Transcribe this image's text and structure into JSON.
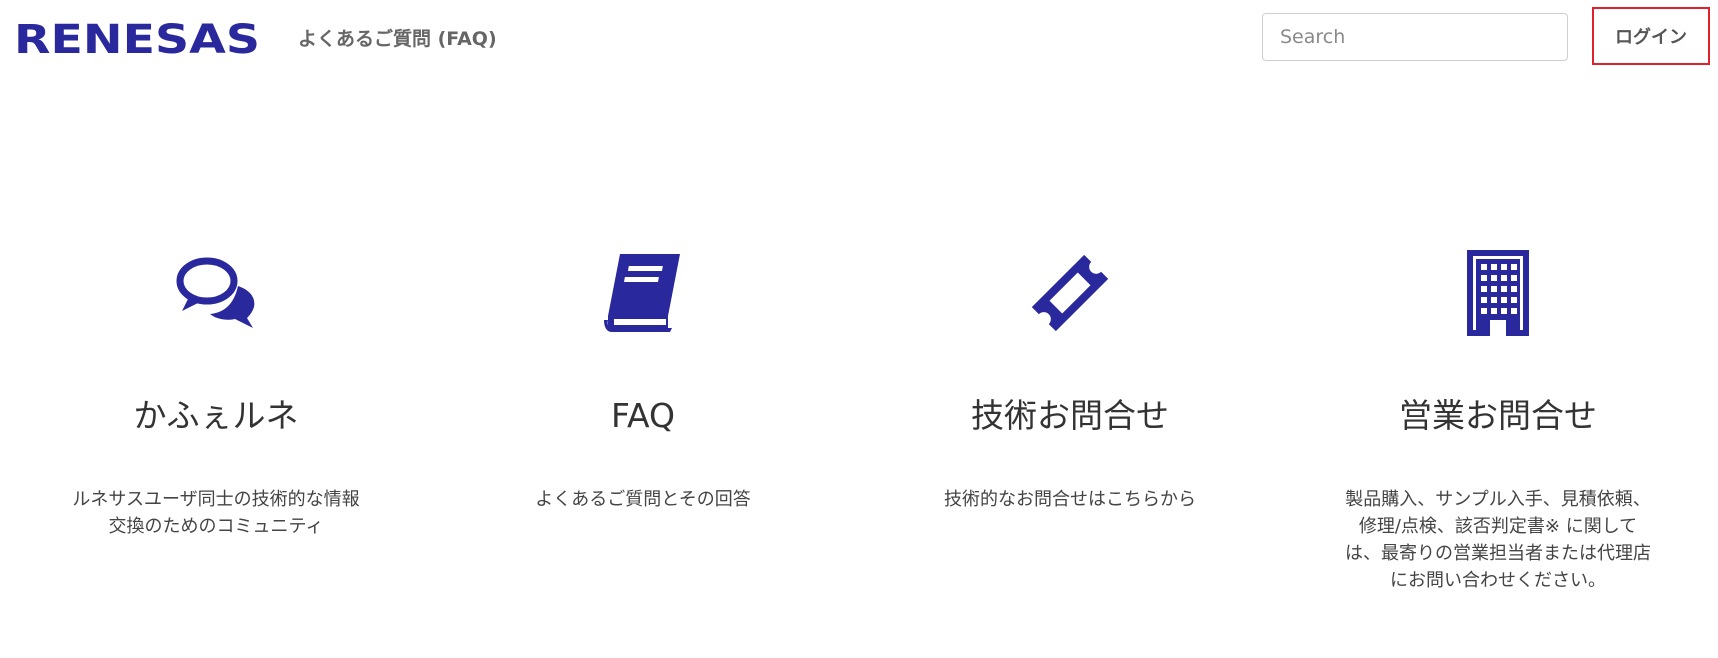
{
  "header": {
    "logo_text": "RENESAS",
    "nav_title": "よくあるご質問 (FAQ)",
    "search_placeholder": "Search",
    "login_label": "ログイン"
  },
  "colors": {
    "brand": "#2a289d",
    "login_border": "#e0202b",
    "nav_text": "#666666"
  },
  "cards": [
    {
      "icon": "comments-icon",
      "title": "かふぇルネ",
      "description": "ルネサスユーザ同士の技術的な情報交換のためのコミュニティ"
    },
    {
      "icon": "book-icon",
      "title": "FAQ",
      "description": "よくあるご質問とその回答"
    },
    {
      "icon": "ticket-icon",
      "title": "技術お問合せ",
      "description": "技術的なお問合せはこちらから"
    },
    {
      "icon": "building-icon",
      "title": "営業お問合せ",
      "description": "製品購入、サンプル入手、見積依頼、修理/点検、該否判定書※ に関しては、最寄りの営業担当者または代理店にお問い合わせください。"
    }
  ]
}
